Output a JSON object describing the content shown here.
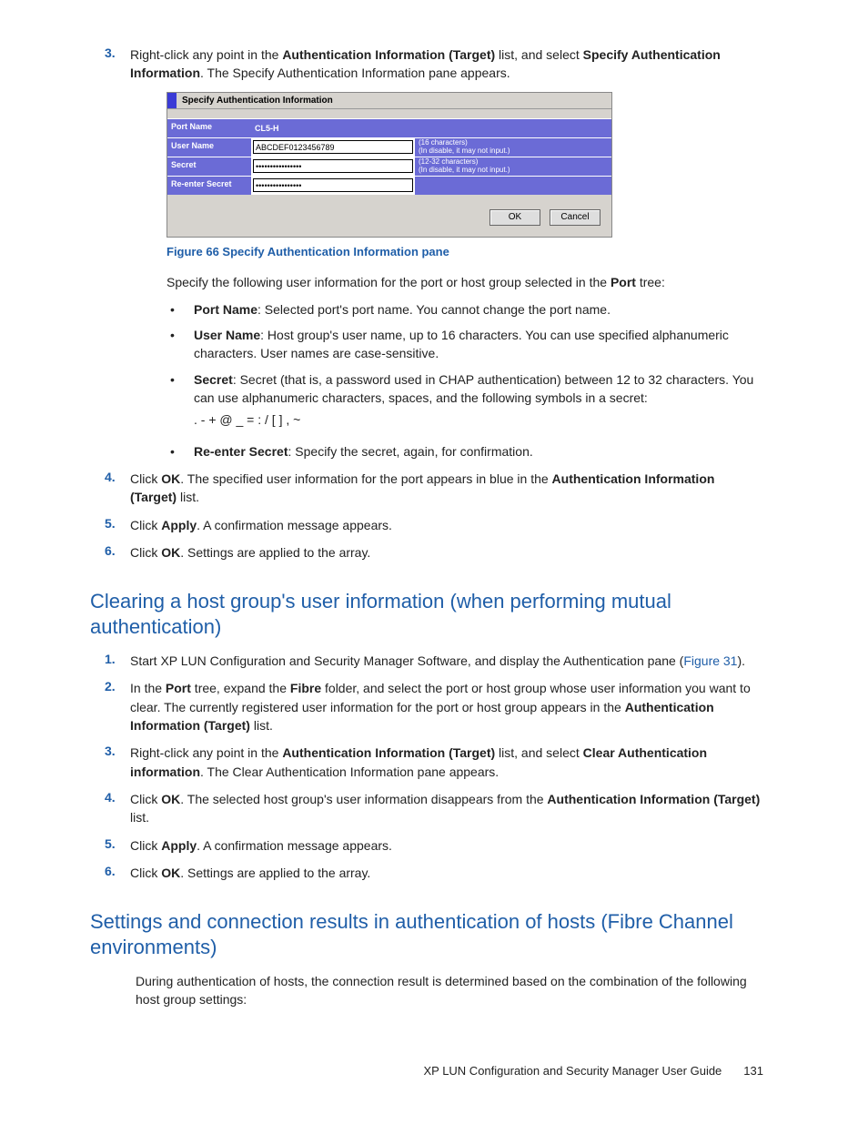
{
  "step3": {
    "num": "3.",
    "text_a": "Right-click any point in the ",
    "bold_a": "Authentication Information (Target)",
    "text_b": " list, and select ",
    "bold_b": "Specify Authentication Information",
    "text_c": ". The Specify Authentication Information pane appears."
  },
  "pane": {
    "title": "Specify Authentication Information",
    "rows": {
      "port_name": {
        "label": "Port Name",
        "value": "CL5-H"
      },
      "user_name": {
        "label": "User Name",
        "value": "ABCDEF0123456789",
        "hint1": "(16 characters)",
        "hint2": "(In disable, it may not input.)"
      },
      "secret": {
        "label": "Secret",
        "value": "****************",
        "hint1": "(12-32 characters)",
        "hint2": "(In disable, it may not input.)"
      },
      "reenter": {
        "label": "Re-enter Secret",
        "value": "****************"
      }
    },
    "buttons": {
      "ok": "OK",
      "cancel": "Cancel"
    }
  },
  "fig_caption": "Figure 66 Specify Authentication Information pane",
  "spec_intro_a": "Specify the following user information for the port or host group selected in the ",
  "spec_intro_bold": "Port",
  "spec_intro_b": " tree:",
  "bullet_portname": {
    "bold": "Port Name",
    "text": ": Selected port's port name. You cannot change the port name."
  },
  "bullet_username": {
    "bold": "User Name",
    "text": ": Host group's user name, up to 16 characters. You can use specified alphanumeric characters. User names are case-sensitive."
  },
  "bullet_secret": {
    "bold": "Secret",
    "text": ": Secret (that is, a password used in CHAP authentication) between 12 to 32 characters. You can use alphanumeric characters, spaces, and the following symbols in a secret:"
  },
  "secret_symbols": ". - + @ _ = : / [ ] , ~",
  "bullet_reenter": {
    "bold": "Re-enter Secret",
    "text": ": Specify the secret, again, for confirmation."
  },
  "step4": {
    "num": "4.",
    "a": "Click ",
    "b1": "OK",
    "c": ". The specified user information for the port appears in blue in the ",
    "b2": "Authentication Information (Target)",
    "d": " list."
  },
  "step5": {
    "num": "5.",
    "a": "Click ",
    "b": "Apply",
    "c": ". A confirmation message appears."
  },
  "step6": {
    "num": "6.",
    "a": "Click ",
    "b": "OK",
    "c": ". Settings are applied to the array."
  },
  "h2_clear": "Clearing a host group's user information (when performing mutual authentication)",
  "c1": {
    "num": "1.",
    "a": "Start XP LUN Configuration and Security Manager Software, and display the Authentication pane (",
    "link": "Figure 31",
    "b": ")."
  },
  "c2": {
    "num": "2.",
    "a": "In the ",
    "b1": "Port",
    "c": " tree, expand the ",
    "b2": "Fibre",
    "d": " folder, and select the port or host group whose user information you want to clear. The currently registered user information for the port or host group appears in the ",
    "b3": "Authentication Information (Target)",
    "e": " list."
  },
  "c3": {
    "num": "3.",
    "a": "Right-click any point in the ",
    "b1": "Authentication Information (Target)",
    "c": " list, and select ",
    "b2": "Clear Authentication information",
    "d": ". The Clear Authentication Information pane appears."
  },
  "c4": {
    "num": "4.",
    "a": "Click ",
    "b1": "OK",
    "c": ". The selected host group's user information disappears from the ",
    "b2": "Authentication Information (Target)",
    "d": " list."
  },
  "c5": {
    "num": "5.",
    "a": "Click ",
    "b": "Apply",
    "c": ". A confirmation message appears."
  },
  "c6": {
    "num": "6.",
    "a": "Click ",
    "b": "OK",
    "c": ". Settings are applied to the array."
  },
  "h2_settings": "Settings and connection results in authentication of hosts (Fibre Channel environments)",
  "settings_intro": "During authentication of hosts, the connection result is determined based on the combination of the following host group settings:",
  "footer": {
    "title": "XP LUN Configuration and Security Manager User Guide",
    "page": "131"
  }
}
